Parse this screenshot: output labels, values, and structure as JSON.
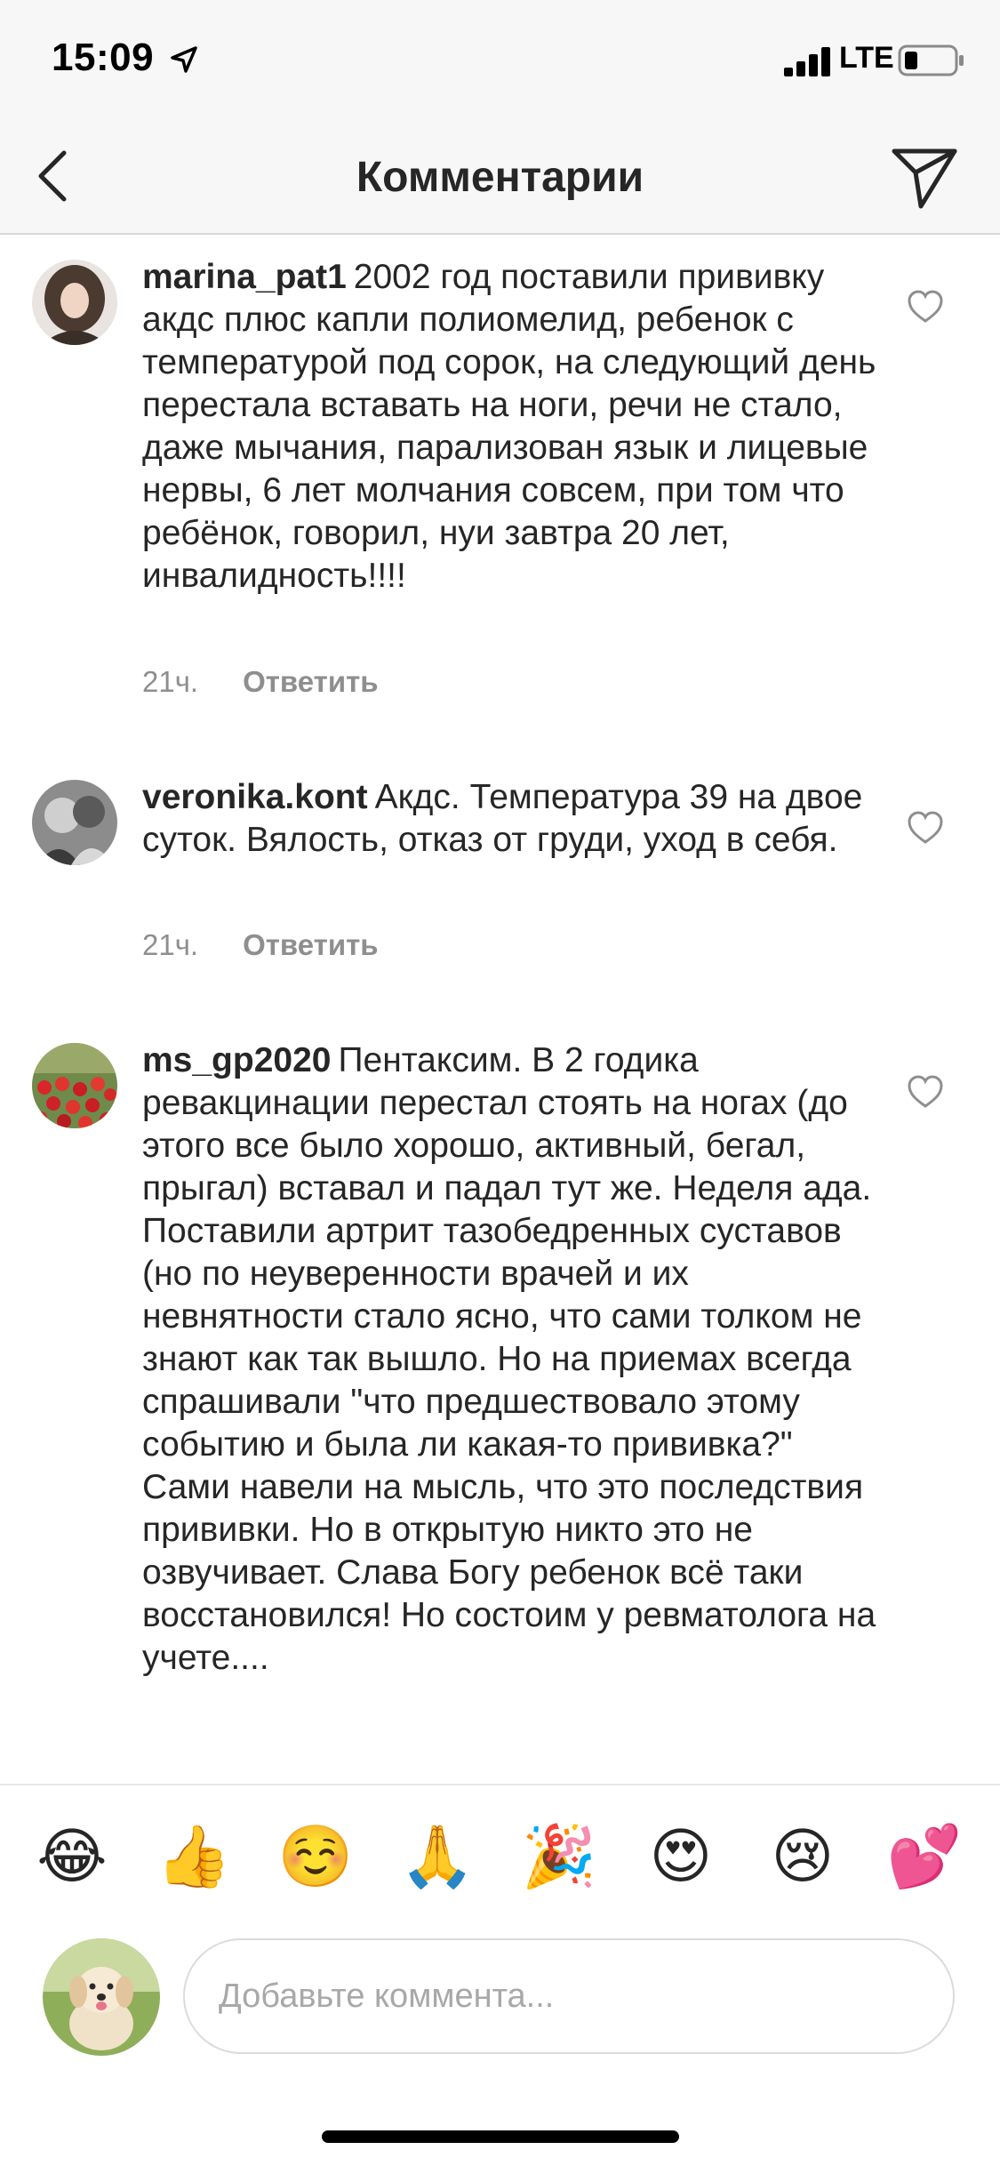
{
  "status_bar": {
    "time": "15:09",
    "network": "LTE"
  },
  "header": {
    "title": "Комментарии"
  },
  "comments": [
    {
      "username": "marina_pat1",
      "text": "2002 год поставили прививку акдс плюс капли полиомелид, ребенок с температурой под сорок, на следующий день перестала вставать на ноги, речи не стало,  даже мычания, парализован язык и лицевые нервы, 6 лет молчания совсем, при том что ребёнок, говорил, нуи завтра 20 лет, инвалидность!!!!",
      "time": "21ч.",
      "reply": "Ответить"
    },
    {
      "username": "veronika.kont",
      "text": "Акдс. Температура 39 на двое суток. Вялость, отказ от груди, уход в себя.",
      "time": "21ч.",
      "reply": "Ответить"
    },
    {
      "username": "ms_gp2020",
      "text": "Пентаксим. В 2 годика ревакцинации перестал стоять на ногах (до этого все было хорошо, активный, бегал, прыгал) вставал и падал тут же. Неделя ада. Поставили артрит тазобедренных суставов (но по неуверенности врачей и их невнятности стало ясно, что сами толком не знают как так вышло. Но на приемах всегда спрашивали \"что предшествовало этому событию и была ли какая-то прививка?\" Сами навели на мысль, что это последствия прививки. Но в открытую никто это не озвучивает. Слава Богу ребенок всё таки восстановился! Но состоим у ревматолога на учете...."
    }
  ],
  "emojis": [
    "😂",
    "👍",
    "☺️",
    "🙏",
    "🎉",
    "😍",
    "😢",
    "💕"
  ],
  "composer": {
    "placeholder": "Добавьте коммента..."
  }
}
